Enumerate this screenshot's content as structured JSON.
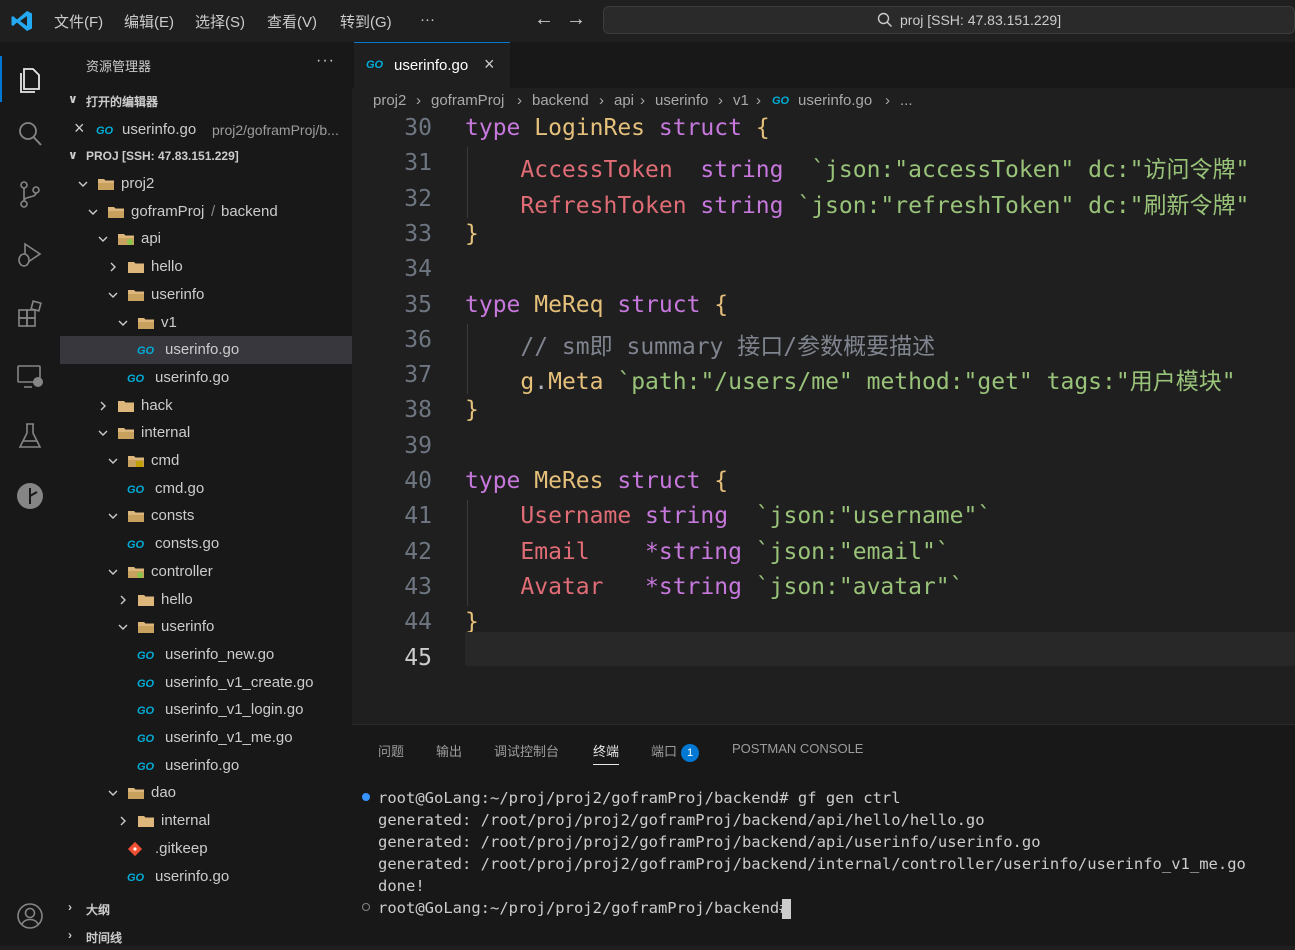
{
  "titlebar": {
    "menus": [
      "文件(F)",
      "编辑(E)",
      "选择(S)",
      "查看(V)",
      "转到(G)",
      "···"
    ],
    "search_text": "proj [SSH: 47.83.151.229]"
  },
  "activity_bar": {
    "items": [
      "explorer-icon",
      "search-icon",
      "source-control-icon",
      "run-debug-icon",
      "extensions-icon",
      "remote-explorer-icon",
      "testing-icon",
      "gitlens-icon",
      "accounts-icon"
    ]
  },
  "sidebar": {
    "title": "资源管理器",
    "more": "···",
    "open_editors_label": "打开的编辑器",
    "open_editor_file": "userinfo.go",
    "open_editor_path": "proj2/goframProj/b...",
    "project_label": "PROJ [SSH: 47.83.151.229]",
    "tree": [
      {
        "name": "proj2",
        "kind": "folder",
        "open": true
      },
      {
        "name": "goframProj",
        "name2": "backend",
        "kind": "folder",
        "open": true
      },
      {
        "name": "api",
        "kind": "folder-special",
        "open": true
      },
      {
        "name": "hello",
        "kind": "folder",
        "open": false
      },
      {
        "name": "userinfo",
        "kind": "folder",
        "open": true
      },
      {
        "name": "v1",
        "kind": "folder",
        "open": true
      },
      {
        "name": "userinfo.go",
        "kind": "go",
        "selected": true
      },
      {
        "name": "userinfo.go",
        "kind": "go"
      },
      {
        "name": "hack",
        "kind": "folder",
        "open": false
      },
      {
        "name": "internal",
        "kind": "folder",
        "open": true
      },
      {
        "name": "cmd",
        "kind": "folder-cmd",
        "open": true
      },
      {
        "name": "cmd.go",
        "kind": "go"
      },
      {
        "name": "consts",
        "kind": "folder",
        "open": true
      },
      {
        "name": "consts.go",
        "kind": "go"
      },
      {
        "name": "controller",
        "kind": "folder-special",
        "open": true
      },
      {
        "name": "hello",
        "kind": "folder",
        "open": false
      },
      {
        "name": "userinfo",
        "kind": "folder",
        "open": true
      },
      {
        "name": "userinfo_new.go",
        "kind": "go"
      },
      {
        "name": "userinfo_v1_create.go",
        "kind": "go"
      },
      {
        "name": "userinfo_v1_login.go",
        "kind": "go"
      },
      {
        "name": "userinfo_v1_me.go",
        "kind": "go"
      },
      {
        "name": "userinfo.go",
        "kind": "go"
      },
      {
        "name": "dao",
        "kind": "folder",
        "open": true
      },
      {
        "name": "internal",
        "kind": "folder",
        "open": false
      },
      {
        "name": ".gitkeep",
        "kind": "git"
      },
      {
        "name": "userinfo.go",
        "kind": "go"
      }
    ],
    "outline_label": "大纲",
    "timeline_label": "时间线"
  },
  "editor": {
    "tab_icon": "GO",
    "tab_label": "userinfo.go",
    "breadcrumb": [
      "proj2",
      "goframProj",
      "backend",
      "api",
      "userinfo",
      "v1",
      "userinfo.go",
      "..."
    ],
    "lines": [
      {
        "n": "30",
        "tokens": [
          [
            "kw",
            "type "
          ],
          [
            "ty",
            "LoginRes "
          ],
          [
            "kw",
            "struct "
          ],
          [
            "ty",
            "{"
          ]
        ]
      },
      {
        "n": "31",
        "tokens": [
          [
            "fd",
            "    AccessToken  "
          ],
          [
            "kw",
            "string  "
          ],
          [
            "st",
            "`json:\"accessToken\" dc:\"访问令牌\""
          ]
        ]
      },
      {
        "n": "32",
        "tokens": [
          [
            "fd",
            "    RefreshToken "
          ],
          [
            "kw",
            "string "
          ],
          [
            "st",
            "`json:\"refreshToken\" dc:\"刷新令牌\""
          ]
        ]
      },
      {
        "n": "33",
        "tokens": [
          [
            "ty",
            "}"
          ]
        ]
      },
      {
        "n": "34",
        "tokens": []
      },
      {
        "n": "35",
        "tokens": [
          [
            "kw",
            "type "
          ],
          [
            "ty",
            "MeReq "
          ],
          [
            "kw",
            "struct "
          ],
          [
            "ty",
            "{"
          ]
        ]
      },
      {
        "n": "36",
        "tokens": [
          [
            "cm",
            "    // sm即 summary 接口/参数概要描述"
          ]
        ]
      },
      {
        "n": "37",
        "tokens": [
          [
            "ty",
            "    g"
          ],
          [
            "pl",
            "."
          ],
          [
            "ty",
            "Meta "
          ],
          [
            "st",
            "`path:\"/users/me\" method:\"get\" tags:\"用户模块\""
          ]
        ]
      },
      {
        "n": "38",
        "tokens": [
          [
            "ty",
            "}"
          ]
        ]
      },
      {
        "n": "39",
        "tokens": []
      },
      {
        "n": "40",
        "tokens": [
          [
            "kw",
            "type "
          ],
          [
            "ty",
            "MeRes "
          ],
          [
            "kw",
            "struct "
          ],
          [
            "ty",
            "{"
          ]
        ]
      },
      {
        "n": "41",
        "tokens": [
          [
            "fd",
            "    Username "
          ],
          [
            "kw",
            "string  "
          ],
          [
            "st",
            "`json:\"username\"`"
          ]
        ]
      },
      {
        "n": "42",
        "tokens": [
          [
            "fd",
            "    Email    "
          ],
          [
            "kw",
            "*string "
          ],
          [
            "st",
            "`json:\"email\"`"
          ]
        ]
      },
      {
        "n": "43",
        "tokens": [
          [
            "fd",
            "    Avatar   "
          ],
          [
            "kw",
            "*string "
          ],
          [
            "st",
            "`json:\"avatar\"`"
          ]
        ]
      },
      {
        "n": "44",
        "tokens": [
          [
            "ty",
            "}"
          ]
        ]
      },
      {
        "n": "45",
        "tokens": []
      }
    ],
    "current_line": "45"
  },
  "panel": {
    "tabs": [
      "问题",
      "输出",
      "调试控制台",
      "终端",
      "端口",
      "POSTMAN CONSOLE"
    ],
    "active_tab": "终端",
    "ports_badge": "1",
    "terminal_lines": [
      "root@GoLang:~/proj/proj2/goframProj/backend# gf gen ctrl",
      "generated: /root/proj/proj2/goframProj/backend/api/hello/hello.go",
      "generated: /root/proj/proj2/goframProj/backend/api/userinfo/userinfo.go",
      "generated: /root/proj/proj2/goframProj/backend/internal/controller/userinfo/userinfo_v1_me.go",
      "done!",
      "root@GoLang:~/proj/proj2/goframProj/backend# "
    ]
  },
  "colors": {
    "accent": "#0078d4",
    "go_icon": "#00acd7",
    "folder": "#dcb67a",
    "keyword": "#c678dd",
    "type": "#e5c07b",
    "field": "#e06c75",
    "string": "#98c379"
  }
}
